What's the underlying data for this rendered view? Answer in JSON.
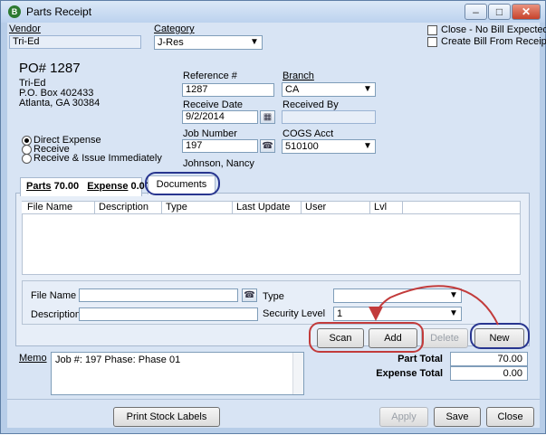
{
  "window": {
    "title": "Parts Receipt",
    "app_icon": "B",
    "controls": [
      "–",
      "□",
      "✕"
    ]
  },
  "vendor": {
    "label": "Vendor",
    "value": "Tri-Ed"
  },
  "category": {
    "label": "Category",
    "value": "J-Res"
  },
  "options": {
    "close_no_bill": "Close - No Bill Expected",
    "create_bill": "Create Bill From Receipt"
  },
  "po": {
    "number": "PO# 1287",
    "address": [
      "Tri-Ed",
      "P.O. Box 402433",
      "Atlanta, GA  30384"
    ]
  },
  "reference": {
    "label": "Reference #",
    "value": "1287"
  },
  "branch": {
    "label": "Branch",
    "value": "CA"
  },
  "receive_date": {
    "label": "Receive Date",
    "value": "9/2/2014"
  },
  "received_by": {
    "label": "Received By",
    "value": ""
  },
  "job_number": {
    "label": "Job Number",
    "value": "197",
    "person": "Johnson, Nancy"
  },
  "cogs": {
    "label": "COGS Acct",
    "value": "510100"
  },
  "receive_mode": {
    "options": [
      "Direct Expense",
      "Receive",
      "Receive & Issue Immediately"
    ],
    "selected": "Direct Expense"
  },
  "tabs": {
    "parts": "Parts",
    "parts_total": "70.00",
    "expense": "Expense",
    "expense_total": "0.00",
    "documents": "Documents"
  },
  "grid": {
    "columns": [
      "File Name",
      "Description",
      "Type",
      "Last Update",
      "User",
      "Lvl"
    ]
  },
  "doc_form": {
    "file_name_label": "File Name",
    "file_name_value": "",
    "description_label": "Description",
    "description_value": "",
    "type_label": "Type",
    "type_value": "",
    "security_label": "Security Level",
    "security_value": "1"
  },
  "doc_buttons": {
    "scan": "Scan",
    "add": "Add",
    "delete": "Delete",
    "new": "New"
  },
  "memo": {
    "label": "Memo",
    "value": "Job #: 197  Phase: Phase 01"
  },
  "totals": {
    "part_total_label": "Part Total",
    "part_total": "70.00",
    "expense_total_label": "Expense Total",
    "expense_total": "0.00"
  },
  "footer": {
    "print_labels": "Print Stock Labels",
    "apply": "Apply",
    "save": "Save",
    "close": "Close"
  },
  "colors": {
    "annotation_red": "#c23b3b",
    "annotation_blue": "#28358f",
    "dialog_background": "#d8e4f4"
  }
}
